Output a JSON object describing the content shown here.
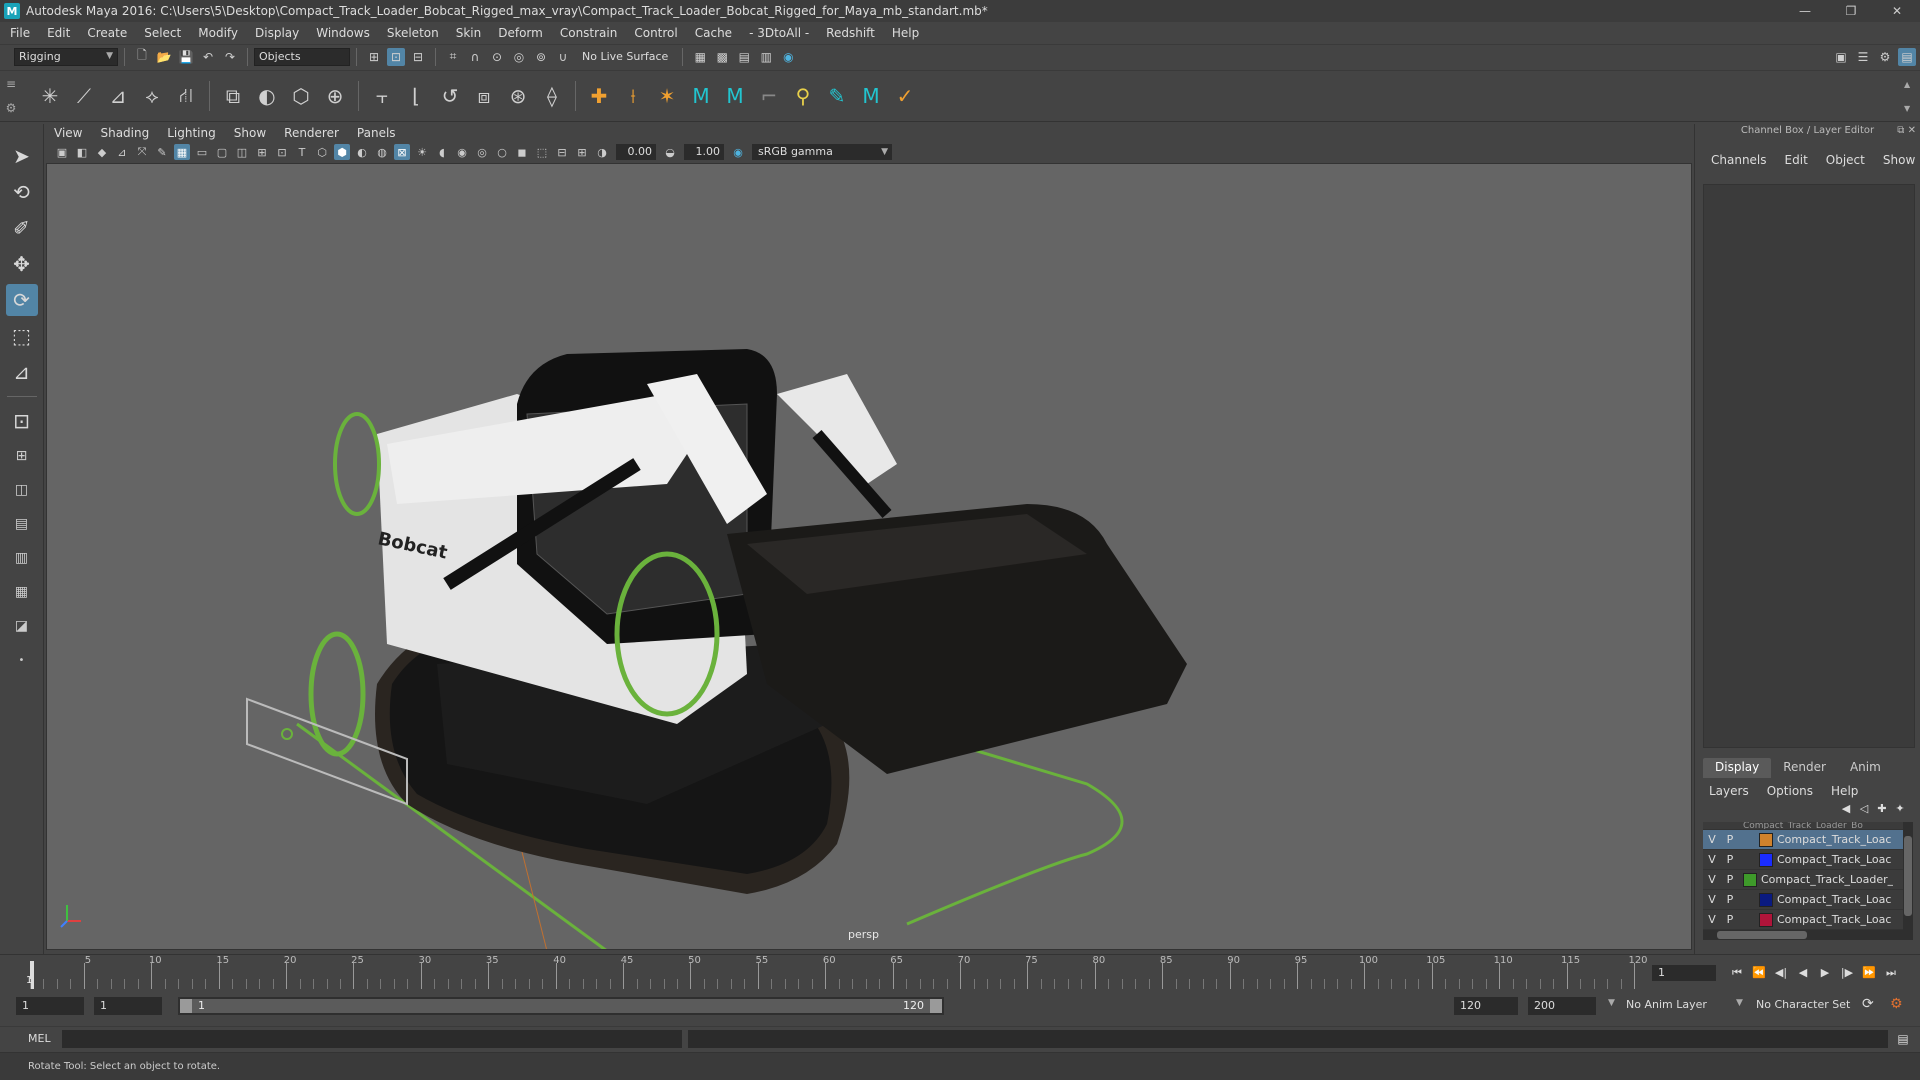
{
  "window": {
    "title": "Autodesk Maya 2016: C:\\Users\\5\\Desktop\\Compact_Track_Loader_Bobcat_Rigged_max_vray\\Compact_Track_Loader_Bobcat_Rigged_for_Maya_mb_standart.mb*",
    "minimize": "—",
    "restore": "❐",
    "close": "✕"
  },
  "menubar": [
    "File",
    "Edit",
    "Create",
    "Select",
    "Modify",
    "Display",
    "Windows",
    "Skeleton",
    "Skin",
    "Deform",
    "Constrain",
    "Control",
    "Cache",
    "- 3DtoAll -",
    "Redshift",
    "Help"
  ],
  "statusline": {
    "mode": "Rigging",
    "selection_mode": "Objects",
    "live_surface": "No Live Surface"
  },
  "panel": {
    "menus": [
      "View",
      "Shading",
      "Lighting",
      "Show",
      "Renderer",
      "Panels"
    ],
    "exposure": "0.00",
    "gamma": "1.00",
    "color_space": "sRGB gamma",
    "camera": "persp"
  },
  "channel_box": {
    "header": "Channel Box / Layer Editor",
    "menus": [
      "Channels",
      "Edit",
      "Object",
      "Show"
    ],
    "tabs": [
      "Display",
      "Render",
      "Anim"
    ],
    "active_tab": "Display",
    "layer_menus": [
      "Layers",
      "Options",
      "Help"
    ],
    "partial_layer": "Compact_Track_Loader_Bo",
    "layers": [
      {
        "v": "V",
        "p": "P",
        "name": "Compact_Track_Loac",
        "color": "#d0822c",
        "selected": true
      },
      {
        "v": "V",
        "p": "P",
        "name": "Compact_Track_Loac",
        "color": "#1a2cff",
        "selected": false
      },
      {
        "v": "V",
        "p": "P",
        "name": "Compact_Track_Loader_",
        "color": "#3e9a2a",
        "selected": false
      },
      {
        "v": "V",
        "p": "P",
        "name": "Compact_Track_Loac",
        "color": "#0a1a80",
        "selected": false
      },
      {
        "v": "V",
        "p": "P",
        "name": "Compact_Track_Loac",
        "color": "#b0143a",
        "selected": false
      }
    ]
  },
  "timeline": {
    "labels": [
      "5",
      "10",
      "15",
      "20",
      "25",
      "30",
      "35",
      "40",
      "45",
      "50",
      "55",
      "60",
      "65",
      "70",
      "75",
      "80",
      "85",
      "90",
      "95",
      "100",
      "105",
      "110",
      "115",
      "120"
    ],
    "start_frame": "1",
    "current_frame": "1"
  },
  "range": {
    "start": "1",
    "playback_start": "1",
    "slider_start": "1",
    "slider_end": "120",
    "playback_end": "120",
    "end": "200",
    "anim_layer": "No Anim Layer",
    "character_set": "No Character Set"
  },
  "command": {
    "label": "MEL"
  },
  "help_line": "Rotate Tool: Select an object to rotate.",
  "colors": {
    "accent": "#5285a6",
    "control_green": "#6ab23c",
    "viewport_bg": "#656565"
  }
}
